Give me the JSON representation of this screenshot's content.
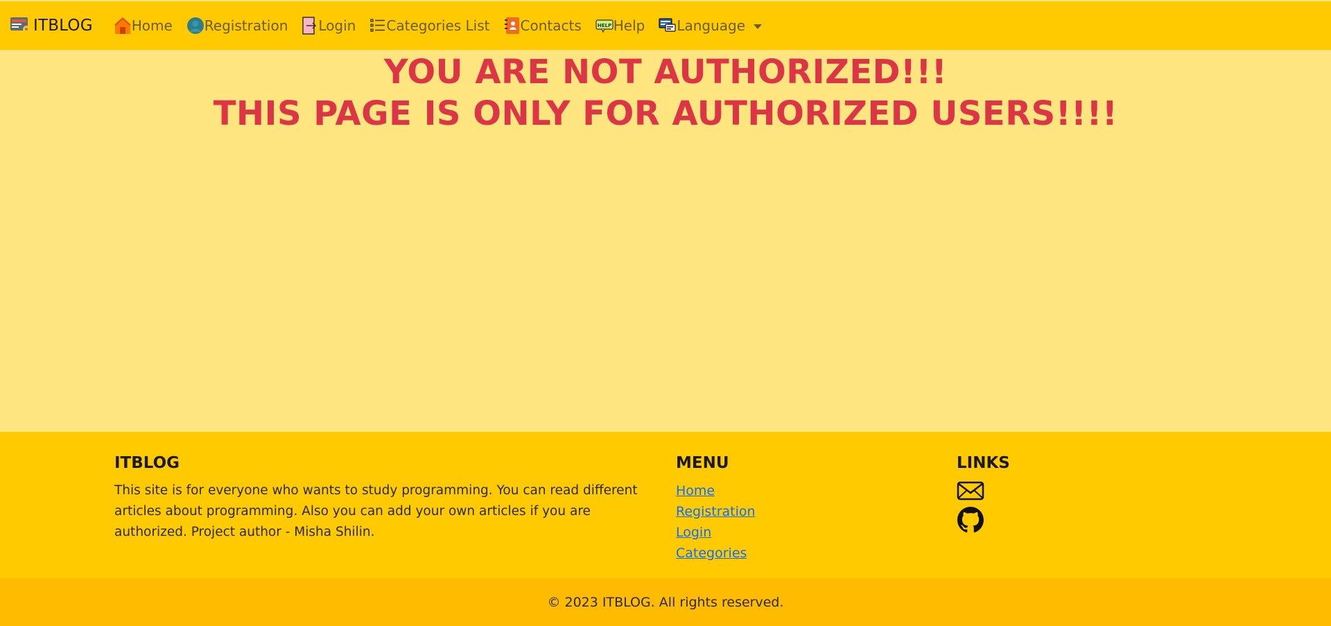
{
  "navbar": {
    "brand": "ITBLOG",
    "items": [
      {
        "label": "Home",
        "icon": "home-icon"
      },
      {
        "label": "Registration",
        "icon": "user-icon"
      },
      {
        "label": "Login",
        "icon": "login-icon"
      },
      {
        "label": "Categories List",
        "icon": "list-icon"
      },
      {
        "label": "Contacts",
        "icon": "contacts-icon"
      },
      {
        "label": "Help",
        "icon": "help-icon"
      },
      {
        "label": "Language",
        "icon": "language-icon"
      }
    ]
  },
  "main": {
    "line1": "YOU ARE NOT AUTHORIZED!!!",
    "line2": "THIS PAGE IS ONLY FOR AUTHORIZED USERS!!!!"
  },
  "footer": {
    "about": {
      "title": "ITBLOG",
      "text": "This site is for everyone who wants to study programming. You can read different articles about programming. Also you can add your own articles if you are authorized. Project author - Misha Shilin."
    },
    "menu": {
      "title": "MENU",
      "items": [
        "Home",
        "Registration",
        "Login",
        "Categories"
      ]
    },
    "links": {
      "title": "LINKS",
      "icons": [
        "mail-icon",
        "github-icon"
      ]
    }
  },
  "copyright": "© 2023 ITBLOG. All rights reserved.",
  "colors": {
    "navbar": "#ffca00",
    "background": "#ffe57f",
    "error_text": "#dc3545",
    "copyright_bar": "#ffbb00",
    "link": "#0d6efd"
  }
}
